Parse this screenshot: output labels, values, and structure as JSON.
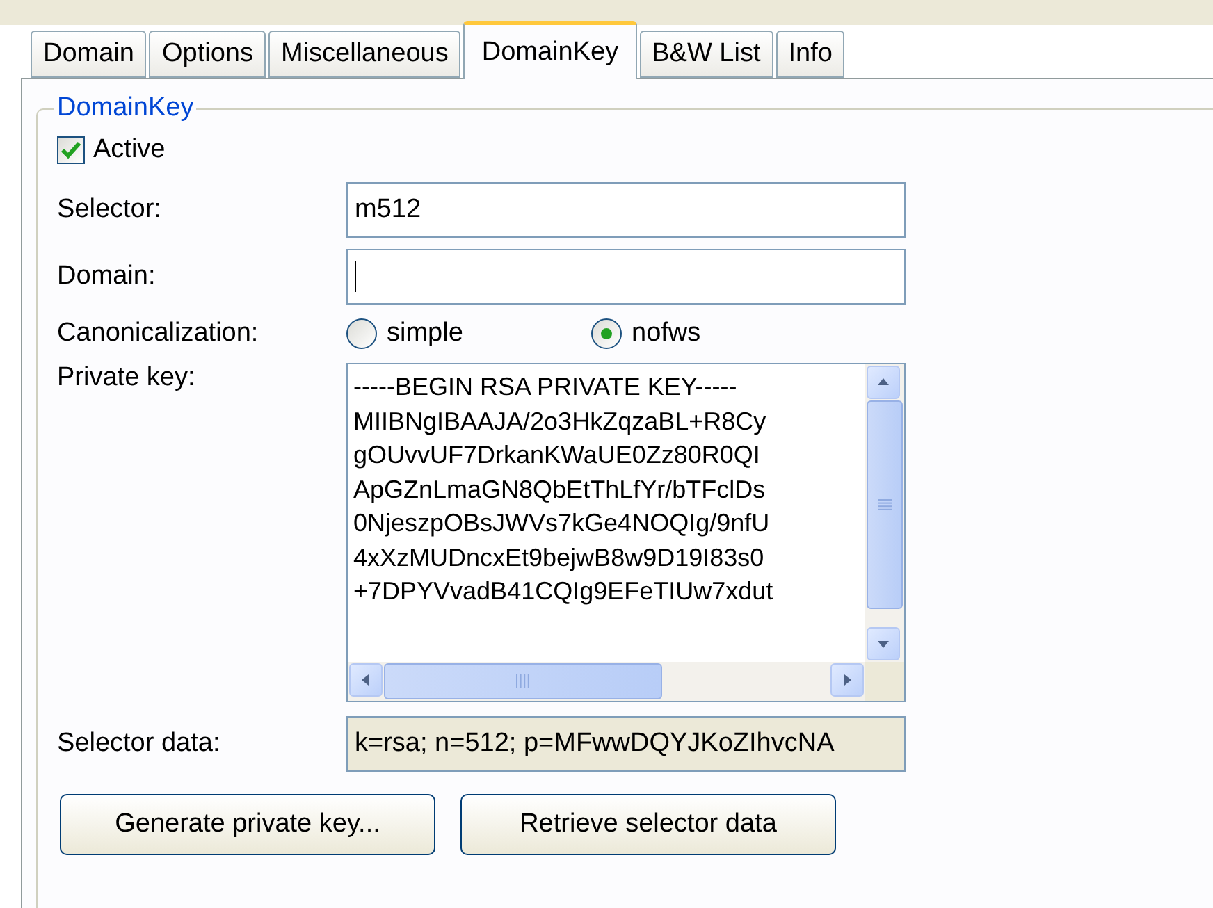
{
  "tabs": [
    {
      "label": "Domain",
      "selected": false
    },
    {
      "label": "Options",
      "selected": false
    },
    {
      "label": "Miscellaneous",
      "selected": false
    },
    {
      "label": "DomainKey",
      "selected": true
    },
    {
      "label": "B&W List",
      "selected": false
    },
    {
      "label": "Info",
      "selected": false
    }
  ],
  "group": {
    "title": "DomainKey",
    "active": {
      "label": "Active",
      "checked": true
    },
    "selector": {
      "label": "Selector:",
      "value": "m512"
    },
    "domain": {
      "label": "Domain:",
      "focused": true
    },
    "canonicalization": {
      "label": "Canonicalization:",
      "options": [
        {
          "label": "simple",
          "selected": false
        },
        {
          "label": "nofws",
          "selected": true
        }
      ]
    },
    "private_key": {
      "label": "Private key:",
      "lines": [
        "-----BEGIN RSA PRIVATE KEY-----",
        "MIIBNgIBAAJA/2o3HkZqzaBL+R8Cy",
        "gOUvvUF7DrkanKWaUE0Zz80R0QI",
        "ApGZnLmaGN8QbEtThLfYr/bTFclDs",
        "0NjeszpOBsJWVs7kGe4NOQIg/9nfU",
        "4xXzMUDncxEt9bejwB8w9D19I83s0",
        "+7DPYVvadB41CQIg9EFeTIUw7xdut"
      ]
    },
    "selector_data": {
      "label": "Selector data:",
      "value": "k=rsa; n=512; p=MFwwDQYJKoZIhvcNA",
      "readonly": true
    },
    "buttons": [
      "Generate private key...",
      "Retrieve selector data"
    ]
  }
}
